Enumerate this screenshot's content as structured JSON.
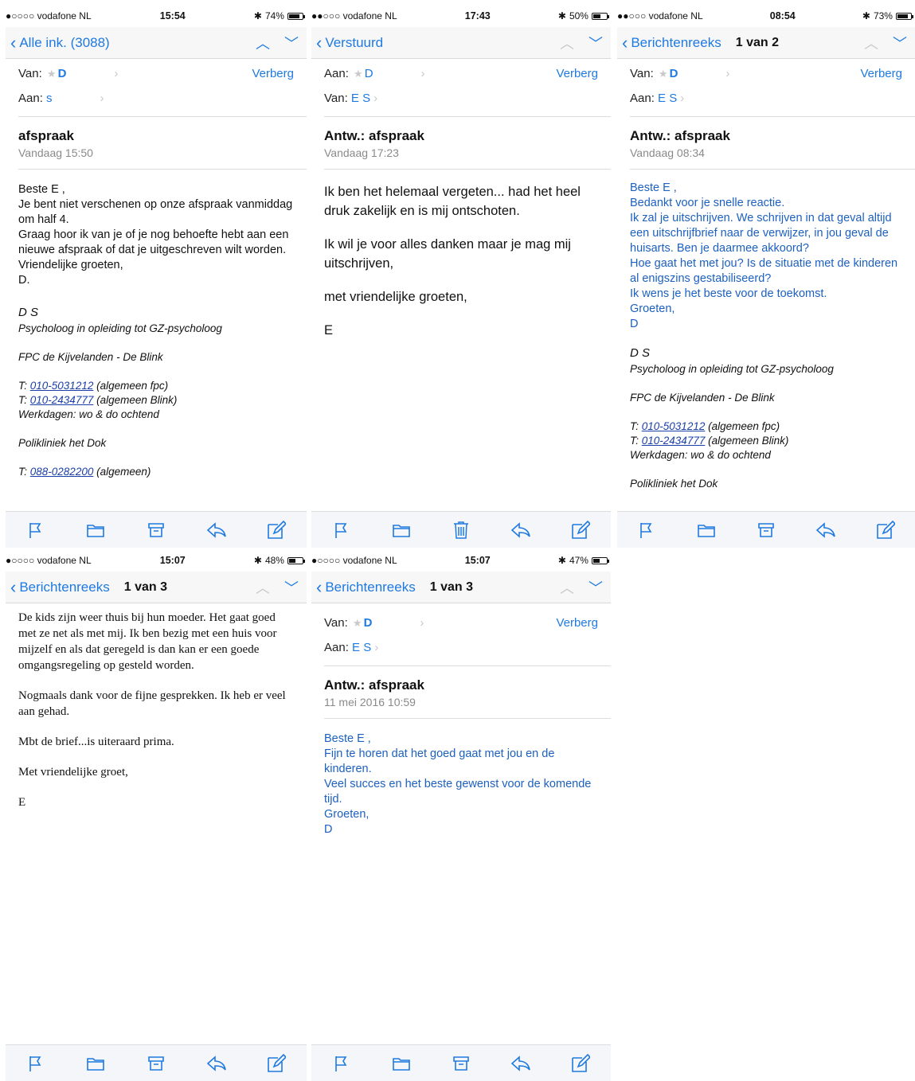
{
  "s1": {
    "status": {
      "carrier": "●○○○○ vodafone NL",
      "time": "15:54",
      "battery": "74%"
    },
    "nav": {
      "back": "Alle ink. (3088)"
    },
    "from_label": "Van:",
    "from": "D",
    "to_label": "Aan:",
    "to": "s",
    "toggle": "Verberg",
    "subject": "afspraak",
    "date": "Vandaag 15:50",
    "body": [
      "Beste E ,",
      "Je bent niet verschenen op onze afspraak vanmiddag om half 4.",
      "Graag hoor ik van je of je nog behoefte hebt aan een nieuwe afspraak of dat je uitgeschreven wilt worden.",
      "Vriendelijke groeten,",
      "D."
    ],
    "sig": {
      "name": "D       S",
      "role": "Psycholoog in opleiding tot GZ-psycholoog",
      "org": "FPC de Kijvelanden - De Blink",
      "t1": "010-5031212",
      "t1s": " (algemeen fpc)",
      "t2": "010-2434777",
      "t2s": " (algemeen Blink)",
      "days": "Werkdagen: wo & do ochtend",
      "poli": "Polikliniek het Dok",
      "t3": "088-0282200",
      "t3s": " (algemeen)",
      "tlabel": "T:"
    }
  },
  "s2": {
    "status": {
      "carrier": "●●○○○ vodafone NL",
      "time": "17:43",
      "battery": "50%"
    },
    "nav": {
      "back": "Verstuurd"
    },
    "from_label": "Aan:",
    "from": "D",
    "to_label": "Van:",
    "to": "E   S",
    "toggle": "Verberg",
    "subject": "Antw.: afspraak",
    "date": "Vandaag 17:23",
    "body": [
      "Ik ben het helemaal vergeten... had het heel druk zakelijk en is mij ontschoten.",
      "Ik wil je voor alles danken maar je mag mij uitschrijven,",
      "met vriendelijke groeten,",
      "E"
    ]
  },
  "s3": {
    "status": {
      "carrier": "●●○○○ vodafone NL",
      "time": "08:54",
      "battery": "73%"
    },
    "nav": {
      "back": "Berichtenreeks",
      "count": "1 van 2"
    },
    "from_label": "Van:",
    "from": "D",
    "to_label": "Aan:",
    "to": "E   S",
    "toggle": "Verberg",
    "subject": "Antw.: afspraak",
    "date": "Vandaag 08:34",
    "body": [
      "Beste E ,",
      "Bedankt voor je snelle reactie.",
      "Ik zal je uitschrijven. We schrijven in dat geval altijd een uitschrijfbrief naar de verwijzer, in jou geval de huisarts. Ben je daarmee akkoord?",
      "Hoe gaat het met jou? Is de situatie met de kinderen al enigszins gestabiliseerd?",
      "Ik wens je het beste voor de toekomst.",
      "Groeten,",
      "D"
    ],
    "sig": {
      "name": "D       S",
      "role": "Psycholoog in opleiding tot GZ-psycholoog",
      "org": "FPC de Kijvelanden - De Blink",
      "t1": "010-5031212",
      "t1s": " (algemeen fpc)",
      "t2": "010-2434777",
      "t2s": " (algemeen Blink)",
      "days": "Werkdagen: wo & do ochtend",
      "poli": "Polikliniek het Dok",
      "tlabel": "T:"
    }
  },
  "s4": {
    "status": {
      "carrier": "●○○○○ vodafone NL",
      "time": "15:07",
      "battery": "48%"
    },
    "nav": {
      "back": "Berichtenreeks",
      "count": "1 van 3"
    },
    "body": [
      "De kids zijn weer thuis bij hun moeder. Het gaat goed met ze net als met mij. Ik ben bezig met een huis voor mijzelf en als dat geregeld is dan kan er een goede omgangsregeling op gesteld worden.",
      "Nogmaals dank voor de fijne gesprekken. Ik heb er veel aan gehad.",
      "Mbt de brief...is uiteraard prima.",
      "Met vriendelijke groet,",
      "E"
    ]
  },
  "s5": {
    "status": {
      "carrier": "●○○○○ vodafone NL",
      "time": "15:07",
      "battery": "47%"
    },
    "nav": {
      "back": "Berichtenreeks",
      "count": "1 van 3"
    },
    "from_label": "Van:",
    "from": "D",
    "to_label": "Aan:",
    "to": "E   S",
    "toggle": "Verberg",
    "subject": "Antw.: afspraak",
    "date": "11 mei 2016 10:59",
    "body": [
      "Beste E ,",
      "Fijn te horen dat het goed gaat met jou en de kinderen.",
      "Veel succes en het beste gewenst voor de komende tijd.",
      "Groeten,",
      "D"
    ]
  },
  "icons": {
    "flag": "flag-icon",
    "folder": "folder-icon",
    "archive": "archive-icon",
    "trash": "trash-icon",
    "reply": "reply-icon",
    "compose": "compose-icon"
  }
}
